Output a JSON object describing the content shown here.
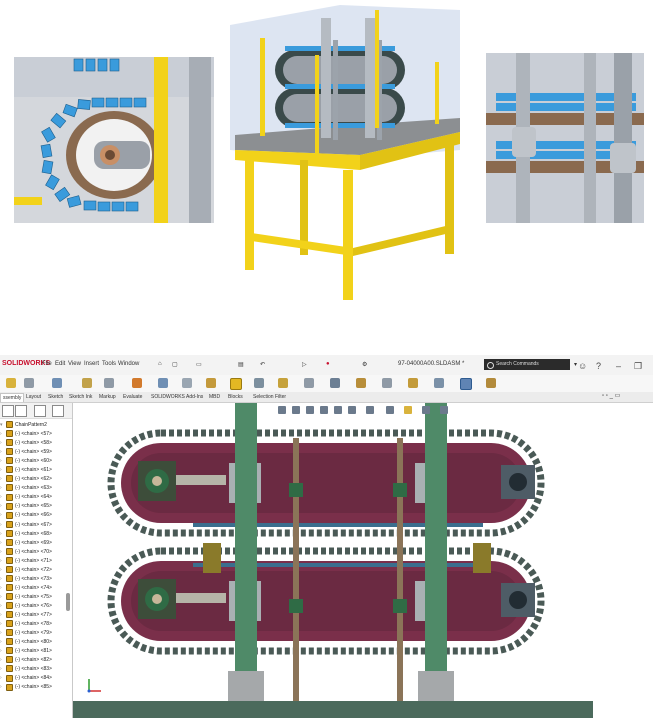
{
  "app": {
    "logo": "SOLIDWORKS",
    "menu": [
      "File",
      "Edit",
      "View",
      "Insert",
      "Tools",
      "Window"
    ],
    "document_title": "97-04000A00.SLDASM *",
    "search_placeholder": "Search Commands"
  },
  "command_tabs": [
    "ssembly",
    "Layout",
    "Sketch",
    "Sketch Ink",
    "Markup",
    "Evaluate",
    "SOLIDWORKS Add-Ins",
    "MBD",
    "Blocks",
    "Selection Filter"
  ],
  "tree": {
    "root": "ChainPattern2",
    "items": [
      "(-) <chain> <57>",
      "(-) <chain> <58>",
      "(-) <chain> <59>",
      "(-) <chain> <60>",
      "(-) <chain> <61>",
      "(-) <chain> <62>",
      "(-) <chain> <63>",
      "(-) <chain> <64>",
      "(-) <chain> <65>",
      "(-) <chain> <66>",
      "(-) <chain> <67>",
      "(-) <chain> <68>",
      "(-) <chain> <69>",
      "(-) <chain> <70>",
      "(-) <chain> <71>",
      "(-) <chain> <72>",
      "(-) <chain> <73>",
      "(-) <chain> <74>",
      "(-) <chain> <75>",
      "(-) <chain> <76>",
      "(-) <chain> <77>",
      "(-) <chain> <78>",
      "(-) <chain> <79>",
      "(-) <chain> <80>",
      "(-) <chain> <81>",
      "(-) <chain> <82>",
      "(-) <chain> <83>",
      "(-) <chain> <84>",
      "(-) <chain> <85>"
    ]
  },
  "colors": {
    "frame_yellow": "#f2d21a",
    "plate_maroon": "#7a2f4a",
    "shaft_green": "#4f8a68",
    "chain_grey": "#4a5a56",
    "link_blue": "#3a9bdc"
  },
  "icons": [
    "home-icon",
    "new-document-icon",
    "open-icon",
    "print-icon",
    "undo-icon",
    "select-arrow-icon",
    "rebuild-icon",
    "options-icon",
    "search-icon",
    "help-icon",
    "minimize-icon",
    "restore-icon"
  ]
}
